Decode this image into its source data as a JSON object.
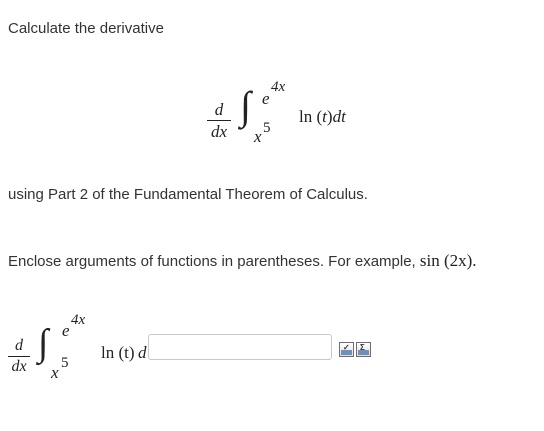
{
  "instruction": "Calculate the derivative",
  "expr_top": {
    "d": "d",
    "dx": "dx",
    "integral": "∫",
    "upper_base": "e",
    "upper_exp": "4x",
    "lower_base": "x",
    "lower_exp": "5",
    "integrand_fn": "ln",
    "integrand_arg": "(t)",
    "integrand_var": "t",
    "differential": "dt"
  },
  "theorem_text": "using Part 2 of the Fundamental Theorem of Calculus.",
  "hint_text": "Enclose arguments of functions in parentheses. For example,",
  "hint_example": "sin (2x).",
  "expr_bottom": {
    "d": "d",
    "dx": "dx",
    "integral": "∫",
    "upper_base": "e",
    "upper_exp": "4x",
    "lower_base": "x",
    "lower_exp": "5",
    "integrand": "ln (t)",
    "clipped": "d"
  },
  "answer": {
    "value": "",
    "placeholder": ""
  },
  "tools": {
    "preview_icon": "preview-icon",
    "symbols_icon": "symbols-icon"
  }
}
